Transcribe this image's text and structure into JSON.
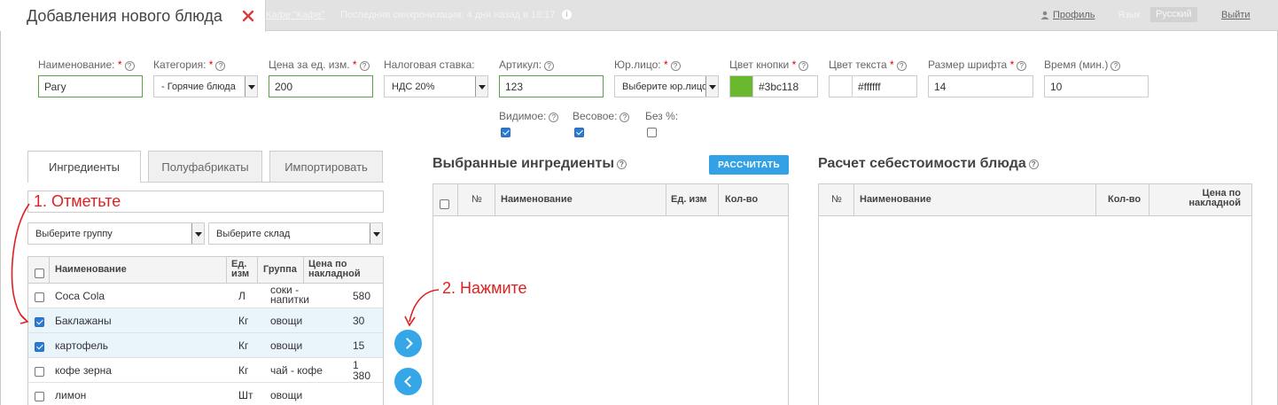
{
  "header": {
    "title": "Добавления нового блюда",
    "cafe_link": "Кафе \"Кафе\"",
    "sync_text": "Последняя синхронизация: 4 дня назад в 18:17",
    "profile": "Профиль",
    "lang_label": "Язык",
    "lang_value": "Русский",
    "logout": "Выйти"
  },
  "form": {
    "name": {
      "label": "Наименование:",
      "req": "*",
      "value": "Рагу"
    },
    "category": {
      "label": "Категория:",
      "req": "*",
      "value": "- Горячие блюда"
    },
    "price": {
      "label": "Цена за ед. изм.",
      "req": "*",
      "value": "200"
    },
    "tax": {
      "label": "Налоговая ставка:",
      "value": "НДС 20%"
    },
    "article": {
      "label": "Артикул:",
      "value": "123"
    },
    "legal": {
      "label": "Юр.лицо:",
      "req": "*",
      "value": "Выберите юр.лицо"
    },
    "btn_color": {
      "label": "Цвет кнопки",
      "req": "*",
      "value": "#3bc118",
      "swatch": "#6ab82e"
    },
    "text_color": {
      "label": "Цвет текста",
      "req": "*",
      "value": "#ffffff",
      "swatch": "#ffffff"
    },
    "font_size": {
      "label": "Размер шрифта",
      "req": "*",
      "value": "14"
    },
    "time": {
      "label": "Время (мин.)",
      "value": "10"
    },
    "visible": {
      "label": "Видимое:",
      "checked": true
    },
    "weight": {
      "label": "Весовое:",
      "checked": true
    },
    "no_percent": {
      "label": "Без %:",
      "checked": false
    }
  },
  "tabs": [
    "Ингредиенты",
    "Полуфабрикаты",
    "Импортировать"
  ],
  "filters": {
    "group": "Выберите группу",
    "warehouse": "Выберите склад"
  },
  "left_table": {
    "headers": {
      "name": "Наименование",
      "unit": "Ед. изм",
      "group": "Группа",
      "price": "Цена по накладной"
    },
    "rows": [
      {
        "name": "Coca Cola",
        "unit": "Л",
        "group": "соки - напитки",
        "price": "580",
        "checked": false
      },
      {
        "name": "Баклажаны",
        "unit": "Кг",
        "group": "овощи",
        "price": "30",
        "checked": true
      },
      {
        "name": "картофель",
        "unit": "Кг",
        "group": "овощи",
        "price": "15",
        "checked": true
      },
      {
        "name": "кофе зерна",
        "unit": "Кг",
        "group": "чай - кофе",
        "price": "1 380",
        "checked": false
      },
      {
        "name": "лимон",
        "unit": "Шт",
        "group": "овощи",
        "price": "",
        "checked": false
      }
    ]
  },
  "selected": {
    "title": "Выбранные ингредиенты",
    "button": "РАССЧИТАТЬ",
    "headers": {
      "num": "№",
      "name": "Наименование",
      "unit": "Ед. изм",
      "qty": "Кол-во"
    }
  },
  "cost": {
    "title": "Расчет себестоимости блюда",
    "headers": {
      "num": "№",
      "name": "Наименование",
      "qty": "Кол-во",
      "price": "Цена по накладной"
    }
  },
  "annotations": {
    "step1": "1. Отметьте",
    "step2": "2. Нажмите"
  }
}
